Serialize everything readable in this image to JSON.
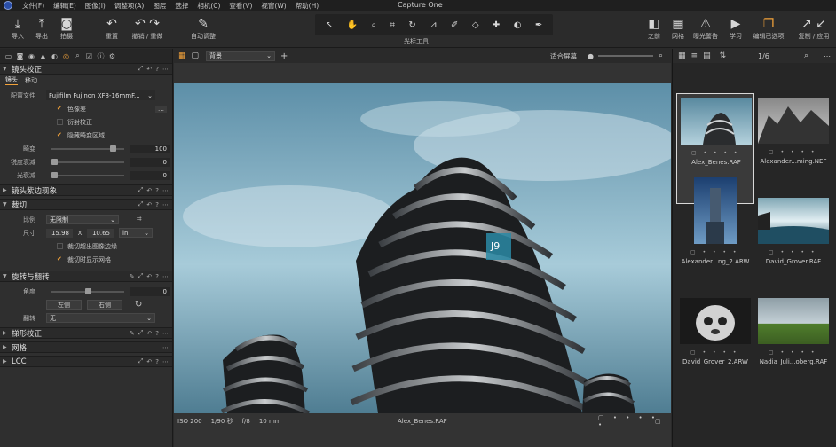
{
  "app_title": "Capture One",
  "menu": [
    "文件(F)",
    "编辑(E)",
    "图像(I)",
    "调整项(A)",
    "图层",
    "选择",
    "相机(C)",
    "查看(V)",
    "视窗(W)",
    "帮助(H)"
  ],
  "toolbar": {
    "import": "导入",
    "export": "导出",
    "capture": "拍摄",
    "reset": "重置",
    "undo_redo": "撤销 / 重做",
    "auto_adjust": "自动调整",
    "cursor_tools": "光标工具",
    "before": "之前",
    "grid": "网格",
    "exposure_warning": "曝光警告",
    "learn": "学习",
    "edit_selected": "编辑已选项",
    "copy_apply": "复制 / 应用"
  },
  "left": {
    "lens": {
      "title": "镜头校正",
      "tabs": [
        "镜头",
        "移动"
      ],
      "profile_label": "配置文件",
      "profile_value": "Fujifilm Fujinon XF8-16mmF...",
      "chromatic": "色像差",
      "diffraction": "衍射校正",
      "hide_distortion": "隐藏畸变区域",
      "distortion_label": "畸变",
      "distortion_value": "100",
      "sharpness_label": "锐度衰减",
      "sharpness_value": "0",
      "light_label": "光衰减",
      "light_value": "0"
    },
    "purple": {
      "title": "镜头紫边现象"
    },
    "crop": {
      "title": "裁切",
      "ratio_label": "比例",
      "ratio_value": "无限制",
      "size_label": "尺寸",
      "width": "15.98",
      "x": "X",
      "height": "10.65",
      "unit": "in",
      "crop_outside": "裁切超出图像边缘",
      "show_mask": "裁切时显示网格"
    },
    "rotate": {
      "title": "旋转与翻转",
      "angle_label": "角度",
      "angle_value": "0",
      "left_btn": "左侧",
      "right_btn": "右侧",
      "flip_label": "翻转",
      "flip_value": "无"
    },
    "keystone": {
      "title": "梯形校正"
    },
    "grid": {
      "title": "网格"
    },
    "lcc": {
      "title": "LCC"
    }
  },
  "viewer": {
    "preset": "背景",
    "fit": "适合屏幕",
    "iso": "ISO 200",
    "shutter": "1/90 秒",
    "aperture": "f/8",
    "focal": "10 mm",
    "filename": "Alex_Benes.RAF"
  },
  "browser": {
    "counter": "1/6",
    "items": [
      {
        "name": "Alex_Benes.RAF"
      },
      {
        "name": "Alexander...ming.NEF"
      },
      {
        "name": "Alexander...ng_2.ARW"
      },
      {
        "name": "David_Grover.RAF"
      },
      {
        "name": "David_Grover_2.ARW"
      },
      {
        "name": "Nadia_Juli...oberg.RAF"
      }
    ]
  },
  "colors": {
    "accent": "#f2a23a",
    "sky": "#9cc5d6",
    "panel": "#2f2f2f"
  }
}
